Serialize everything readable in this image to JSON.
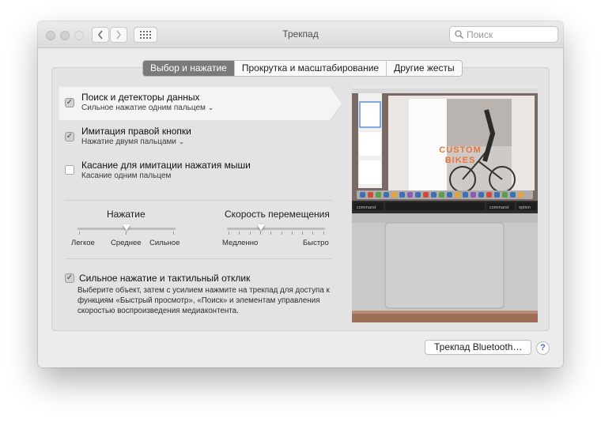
{
  "window": {
    "title": "Трекпад"
  },
  "search": {
    "placeholder": "Поиск"
  },
  "tabs": [
    {
      "label": "Выбор и нажатие",
      "active": true
    },
    {
      "label": "Прокрутка и масштабирование",
      "active": false
    },
    {
      "label": "Другие жесты",
      "active": false
    }
  ],
  "options": [
    {
      "title": "Поиск и детекторы данных",
      "subtitle": "Сильное нажатие одним пальцем",
      "checked": true,
      "has_dropdown": true
    },
    {
      "title": "Имитация правой кнопки",
      "subtitle": "Нажатие двумя пальцами",
      "checked": true,
      "has_dropdown": true
    },
    {
      "title": "Касание для имитации нажатия мыши",
      "subtitle": "Касание одним пальцем",
      "checked": false,
      "has_dropdown": false
    }
  ],
  "click_slider": {
    "label": "Нажатие",
    "min_label": "Легкое",
    "mid_label": "Среднее",
    "max_label": "Сильное",
    "value": 0.5
  },
  "speed_slider": {
    "label": "Скорость перемещения",
    "min_label": "Медленно",
    "max_label": "Быстро",
    "value": 0.35
  },
  "force_click": {
    "title": "Сильное нажатие и тактильный отклик",
    "checked": true,
    "description": "Выберите объект, затем с усилием нажмите на трекпад для доступа к функциям «Быстрый просмотр», «Поиск» и элементам управления скоростью воспроизведения медиаконтента."
  },
  "preview": {
    "poster_text_1": "CUSTOM",
    "poster_text_2": "BIKES",
    "key_left": "command",
    "key_right1": "command",
    "key_right2": "option"
  },
  "buttons": {
    "bluetooth": "Трекпад Bluetooth…",
    "help": "?"
  },
  "colors": {
    "active_tab": "#7a7a7a",
    "accent_text": "#e8743a",
    "help": "#3a6fd8"
  }
}
